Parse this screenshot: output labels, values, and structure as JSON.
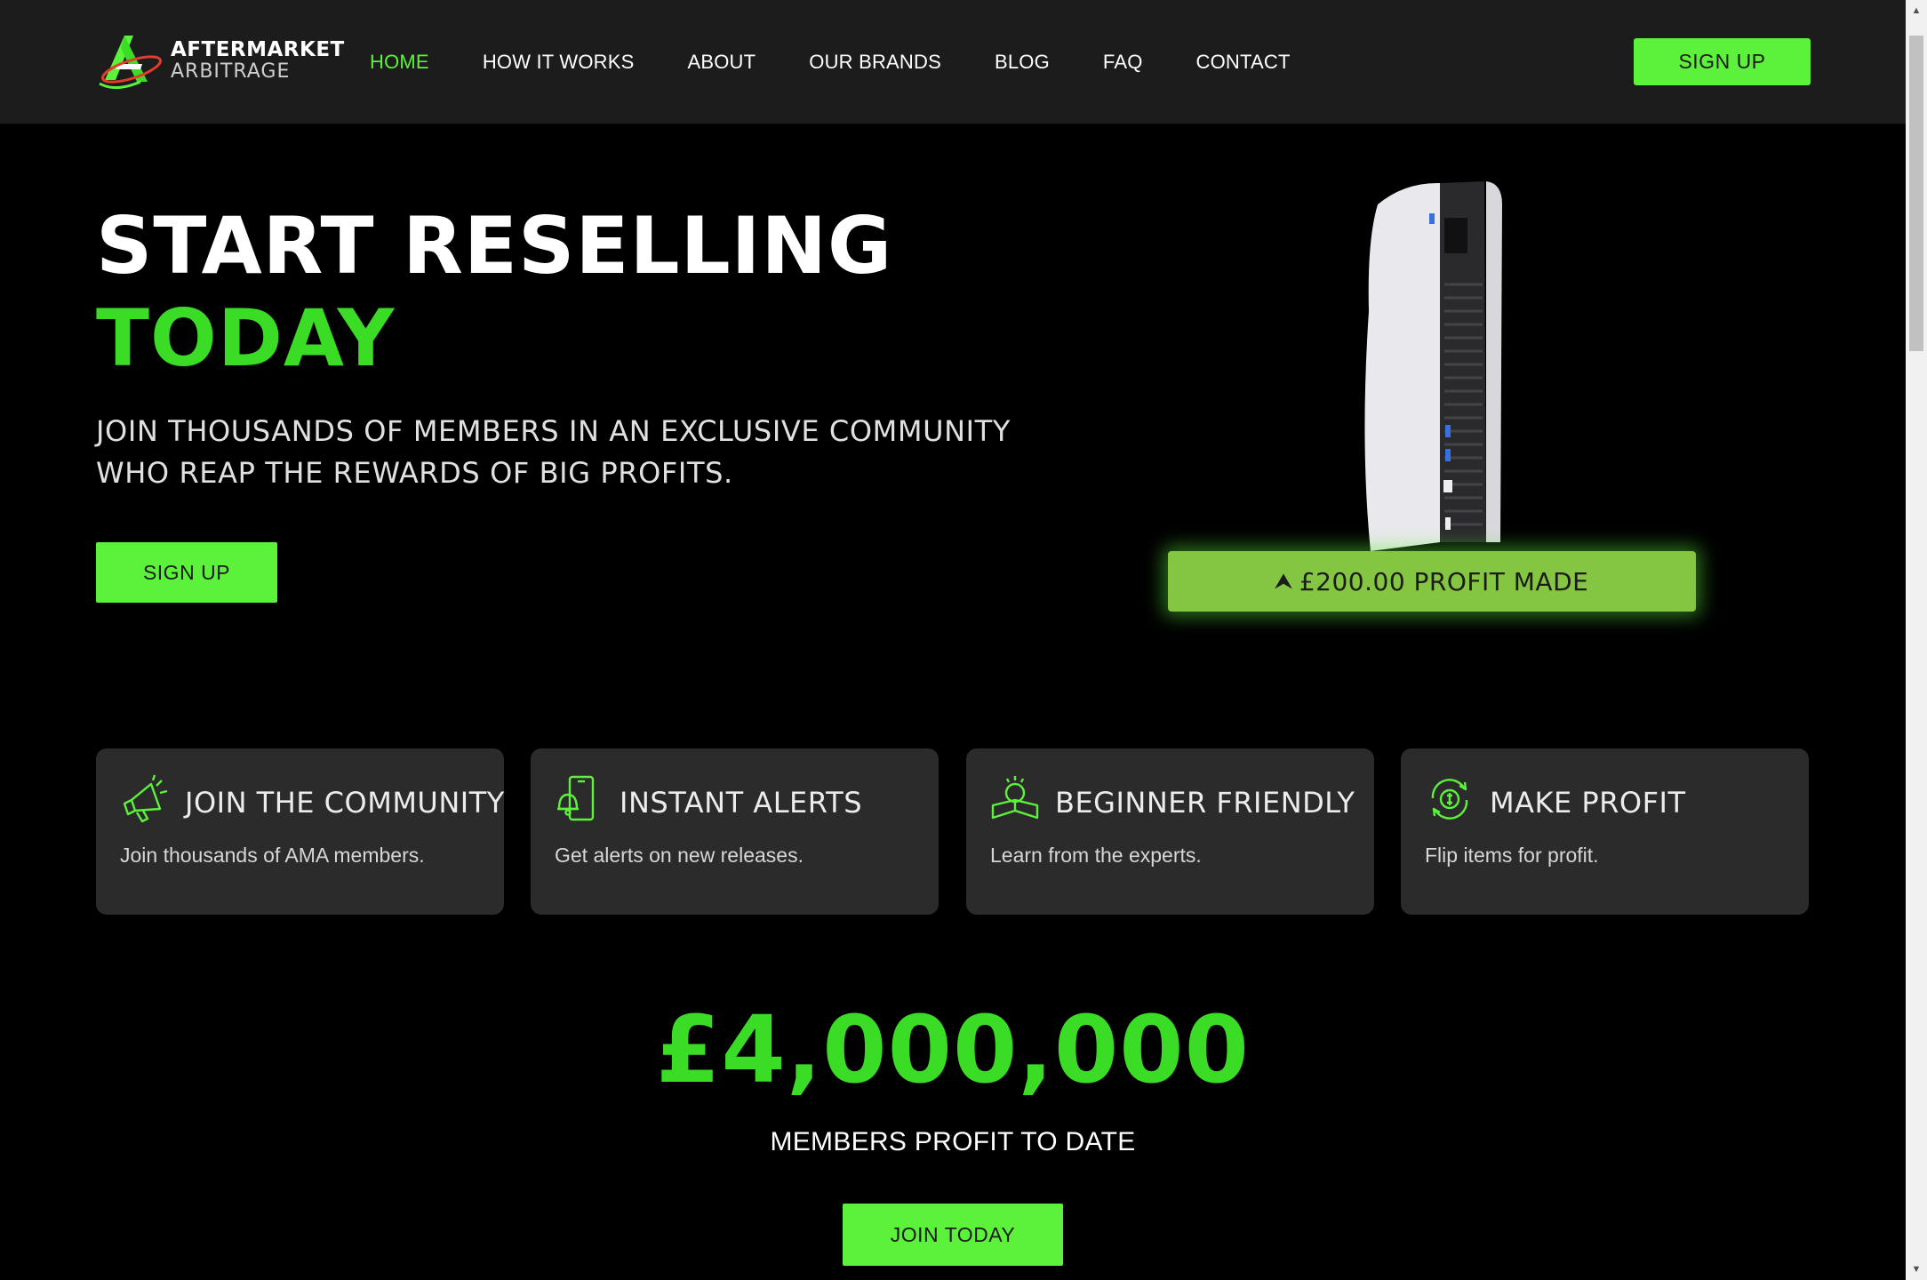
{
  "brand": {
    "line1": "AFTERMARKET",
    "line2": "ARBITRAGE",
    "accent": "#5cf23b",
    "headline_green": "#3bdc25"
  },
  "nav": {
    "items": [
      {
        "label": "HOME",
        "active": true
      },
      {
        "label": "HOW IT WORKS"
      },
      {
        "label": "ABOUT"
      },
      {
        "label": "OUR BRANDS"
      },
      {
        "label": "BLOG"
      },
      {
        "label": "FAQ"
      },
      {
        "label": "CONTACT"
      }
    ],
    "signup_label": "SIGN UP"
  },
  "hero": {
    "title_line1": "START RESELLING",
    "title_line2": "TODAY",
    "subtitle": "JOIN THOUSANDS OF MEMBERS IN AN EXCLUSIVE COMMUNITY WHO REAP THE REWARDS OF BIG PROFITS.",
    "signup_label": "SIGN UP",
    "badge": {
      "icon": "double-chevron-up-icon",
      "text": "£200.00 PROFIT MADE"
    }
  },
  "features": [
    {
      "icon": "megaphone-icon",
      "title": "JOIN THE COMMUNITY",
      "desc": "Join thousands of AMA members."
    },
    {
      "icon": "phone-bell-icon",
      "title": "INSTANT ALERTS",
      "desc": "Get alerts on new releases."
    },
    {
      "icon": "reading-person-icon",
      "title": "BEGINNER FRIENDLY",
      "desc": "Learn from the experts."
    },
    {
      "icon": "coin-cycle-icon",
      "title": "MAKE PROFIT",
      "desc": "Flip items for profit."
    }
  ],
  "stats": {
    "value": "£4,000,000",
    "label": "MEMBERS PROFIT TO DATE",
    "cta_label": "JOIN TODAY"
  }
}
